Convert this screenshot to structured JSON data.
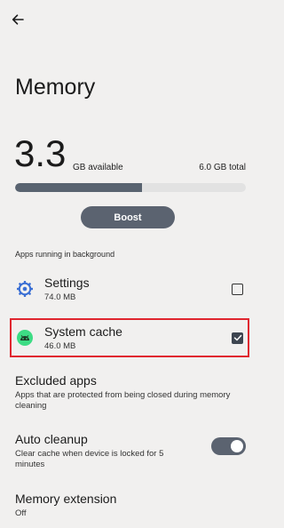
{
  "header": {
    "back_icon": "arrow-left-icon",
    "title": "Memory"
  },
  "memory": {
    "available_value": "3.3",
    "available_label": "GB available",
    "total_label": "6.0 GB total",
    "used_fraction": 0.55,
    "bar_fill_color": "#596370"
  },
  "boost_label": "Boost",
  "background_section_label": "Apps running in background",
  "apps": [
    {
      "name": "Settings",
      "size": "74.0 MB",
      "icon": "settings-gear-icon",
      "checked": false,
      "highlighted": false
    },
    {
      "name": "System cache",
      "size": "46.0 MB",
      "icon": "android-icon",
      "checked": true,
      "highlighted": true
    }
  ],
  "settings": {
    "excluded": {
      "title": "Excluded apps",
      "description": "Apps that are protected from being closed during memory cleaning"
    },
    "auto_cleanup": {
      "title": "Auto cleanup",
      "description": "Clear cache when device is locked for 5 minutes",
      "enabled": true
    },
    "extension": {
      "title": "Memory extension",
      "value": "Off"
    }
  },
  "colors": {
    "accent": "#5b6370",
    "highlight_border": "#e0262f",
    "settings_icon": "#3b6fd4",
    "android_icon": "#3ddc84"
  }
}
